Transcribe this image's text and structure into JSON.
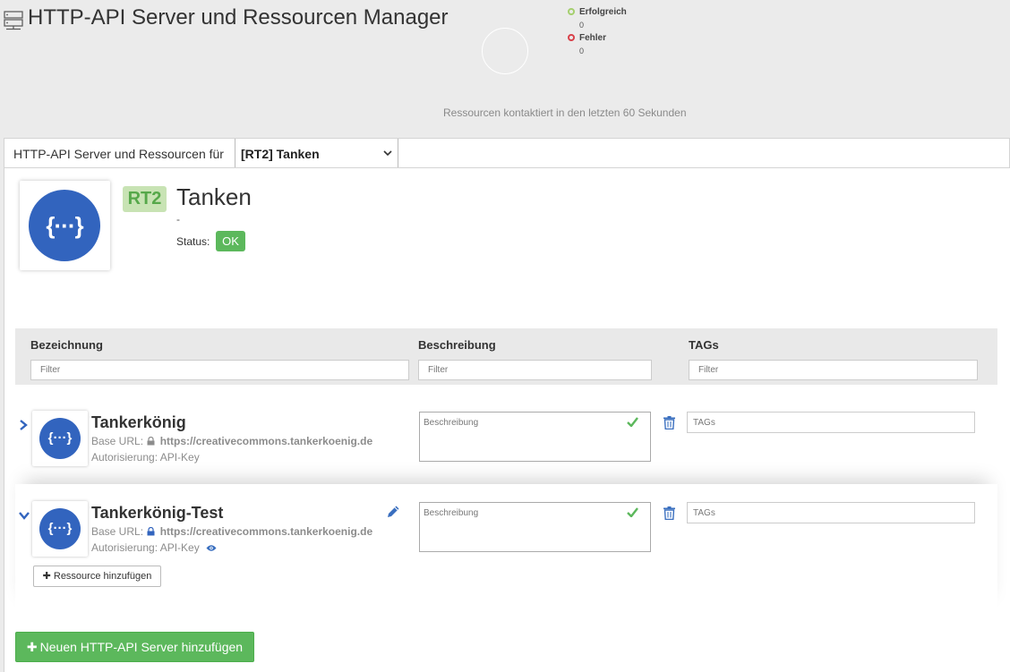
{
  "header": {
    "title": "HTTP-API Server und Ressourcen Manager"
  },
  "stats": {
    "legend": [
      {
        "name": "Erfolgreich",
        "count": "0",
        "color": "#a5cf6e"
      },
      {
        "name": "Fehler",
        "count": "0",
        "color": "#d9414a"
      }
    ],
    "caption": "Ressourcen kontaktiert in den letzten 60 Sekunden"
  },
  "selector": {
    "label": "HTTP-API Server und Ressourcen für",
    "selected": "[RT2] Tanken"
  },
  "server": {
    "badge": "RT2",
    "name": "Tanken",
    "description": "-",
    "status_label": "Status:",
    "status": "OK",
    "logo_glyph": "{···}"
  },
  "table": {
    "columns": [
      "Bezeichnung",
      "Beschreibung",
      "TAGs"
    ],
    "filter_placeholder": "Filter"
  },
  "resources": [
    {
      "name": "Tankerkönig",
      "base_url_label": "Base URL:",
      "base_url": "https://creativecommons.tankerkoenig.de",
      "auth_label": "Autorisierung:",
      "auth": "API-Key",
      "description_placeholder": "Beschreibung",
      "tags_placeholder": "TAGs",
      "expanded": false
    },
    {
      "name": "Tankerkönig-Test",
      "base_url_label": "Base URL:",
      "base_url": "https://creativecommons.tankerkoenig.de",
      "auth_label": "Autorisierung:",
      "auth": "API-Key",
      "description_placeholder": "Beschreibung",
      "tags_placeholder": "TAGs",
      "expanded": true
    }
  ],
  "actions": {
    "add_resource": "Ressource hinzufügen",
    "add_server": "Neuen HTTP-API Server hinzufügen"
  },
  "colors": {
    "accent_blue": "#3264be",
    "success_green": "#5cb85c",
    "badge_green_bg": "#c8e3b4",
    "badge_green_text": "#56a84a"
  }
}
